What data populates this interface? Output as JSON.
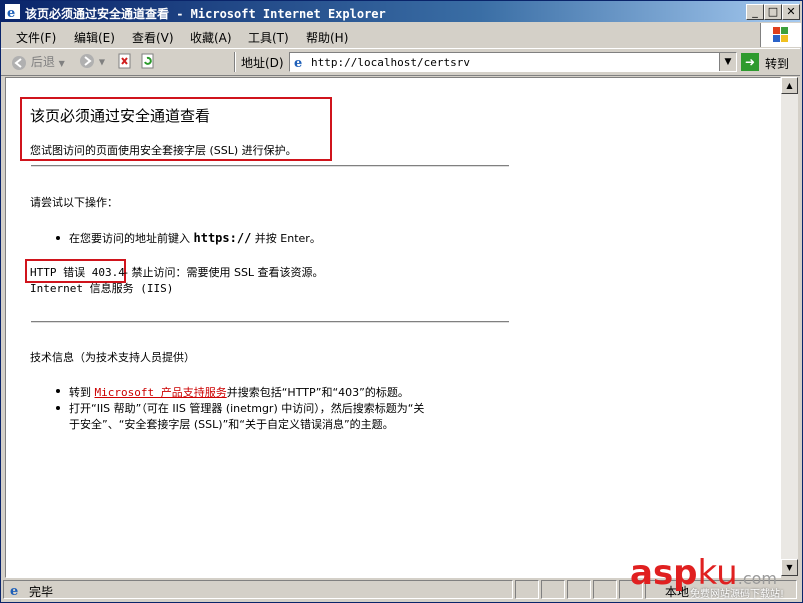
{
  "window": {
    "title": "该页必须通过安全通道查看 - Microsoft Internet Explorer",
    "minimize": "_",
    "maximize": "□",
    "close": "✕"
  },
  "menu": {
    "items": [
      "文件(F)",
      "编辑(E)",
      "查看(V)",
      "收藏(A)",
      "工具(T)",
      "帮助(H)"
    ]
  },
  "toolbar": {
    "back_label": "后退",
    "address_label": "地址(D)",
    "url": "http://localhost/certsrv",
    "go_label": "转到"
  },
  "content": {
    "heading": "该页必须通过安全通道查看",
    "intro": "您试图访问的页面使用安全套接字层 (SSL) 进行保护。",
    "try_label": "请尝试以下操作：",
    "try_item_prefix": "在您要访问的地址前键入",
    "try_item_https": "https://",
    "try_item_suffix": "并按 Enter。",
    "error_code": "HTTP 错误 403.4",
    "error_desc": "- 禁止访问：需要使用 SSL 查看该资源。",
    "iis_line": "Internet 信息服务 (IIS)",
    "tech_label": "技术信息（为技术支持人员提供）",
    "tech_item1_prefix": "转到",
    "tech_item1_link": "Microsoft 产品支持服务",
    "tech_item1_suffix": "并搜索包括“HTTP”和“403”的标题。",
    "tech_item2_line1": "打开“IIS 帮助”（可在 IIS 管理器 (inetmgr) 中访问），然后搜索标题为“关",
    "tech_item2_line2": "于安全”、“安全套接字层 (SSL)”和“关于自定义错误消息”的主题。"
  },
  "status": {
    "text": "完毕",
    "zone": "本地"
  },
  "watermark": {
    "asp": "asp",
    "ku": "ku",
    "com": ".com",
    "sub": "免费网站源码下载站!"
  },
  "colors": {
    "title_bar": "#0a246a",
    "highlight_box": "#d0141c",
    "link": "#cc0000"
  }
}
